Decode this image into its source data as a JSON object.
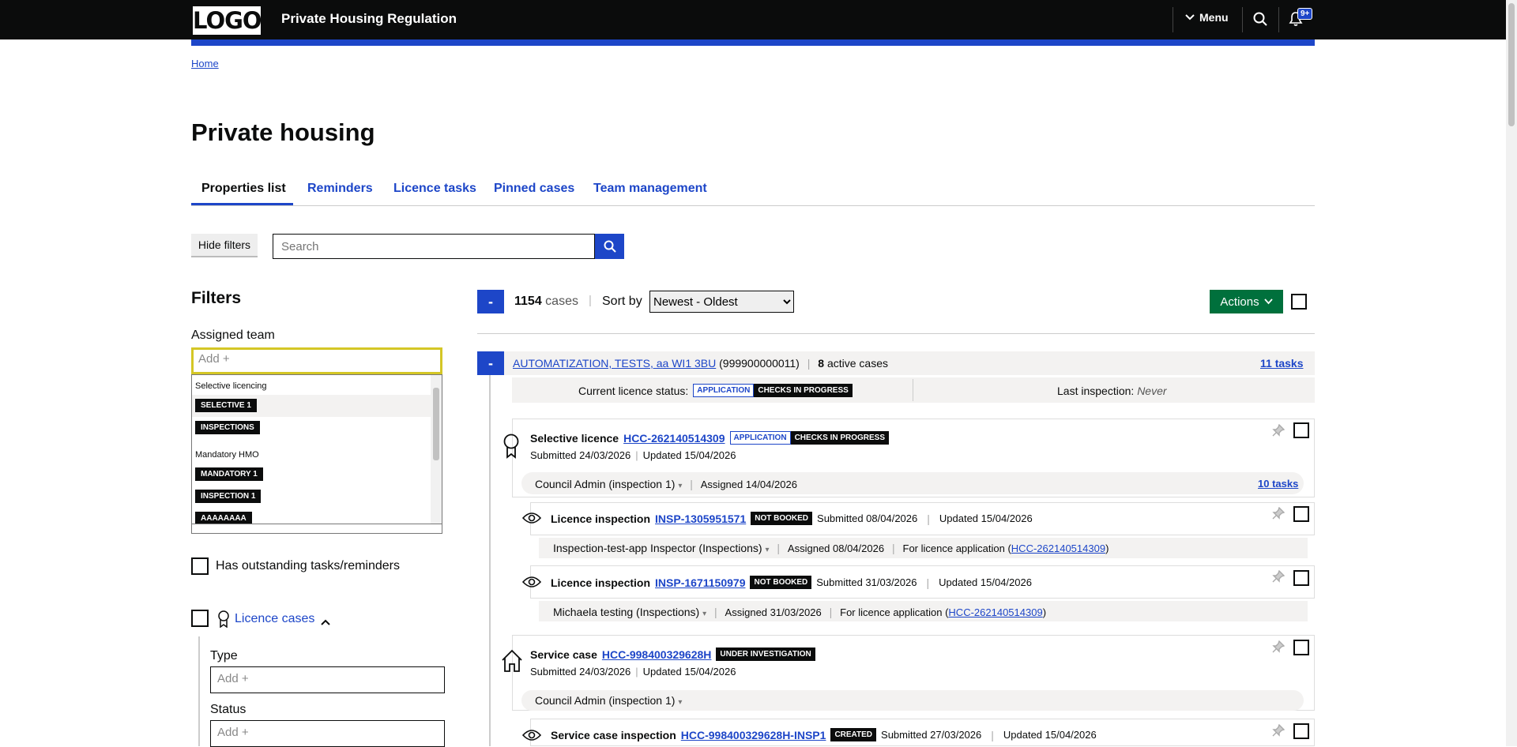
{
  "header": {
    "logo": "LOGO",
    "app_title": "Private Housing Regulation",
    "menu_label": "Menu",
    "notifications_badge": "9+"
  },
  "breadcrumb": {
    "home": "Home"
  },
  "page": {
    "title": "Private housing"
  },
  "tabs": [
    {
      "label": "Properties list",
      "active": true
    },
    {
      "label": "Reminders"
    },
    {
      "label": "Licence tasks"
    },
    {
      "label": "Pinned cases"
    },
    {
      "label": "Team management"
    }
  ],
  "toolbar": {
    "hide_filters": "Hide filters",
    "search_placeholder": "Search"
  },
  "filters": {
    "heading": "Filters",
    "assigned_team_label": "Assigned team",
    "assigned_team_placeholder": "Add +",
    "dropdown": {
      "group1": "Selective licencing",
      "group1_items": [
        "SELECTIVE 1",
        "INSPECTIONS"
      ],
      "group2": "Mandatory HMO",
      "group2_items": [
        "MANDATORY 1",
        "INSPECTION 1",
        "AAAAAAAA"
      ]
    },
    "outstanding_label": "Has outstanding tasks/reminders",
    "licence_cases_label": "Licence cases",
    "type_label": "Type",
    "type_placeholder": "Add +",
    "status_label": "Status",
    "status_placeholder": "Add +"
  },
  "results": {
    "collapse": "-",
    "count": "1154",
    "count_suffix": "cases",
    "sort_label": "Sort by",
    "sort_value": "Newest - Oldest",
    "actions_label": "Actions"
  },
  "property": {
    "collapse": "-",
    "address": "AUTOMATIZATION, TESTS, aa WI1 3BU",
    "uprn": "(999900000011)",
    "active_count": "8",
    "active_suffix": "active cases",
    "tasks": "11 tasks",
    "licence_status_label": "Current licence status:",
    "status_tag1": "APPLICATION",
    "status_tag2": "CHECKS IN PROGRESS",
    "last_inspection_label": "Last inspection:",
    "last_inspection_value": "Never"
  },
  "cases": {
    "selective": {
      "type": "Selective licence",
      "ref": "HCC-262140514309",
      "tag1": "APPLICATION",
      "tag2": "CHECKS IN PROGRESS",
      "submitted": "Submitted 24/03/2026",
      "updated": "Updated 15/04/2026",
      "assignee": "Council Admin (inspection 1)",
      "assigned": "Assigned 14/04/2026",
      "tasks": "10 tasks"
    },
    "inspection1": {
      "type": "Licence inspection",
      "ref": "INSP-1305951571",
      "tag": "NOT BOOKED",
      "submitted": "Submitted 08/04/2026",
      "updated": "Updated 15/04/2026",
      "assignee": "Inspection-test-app Inspector (Inspections)",
      "assigned": "Assigned 08/04/2026",
      "for_label": "For licence application (",
      "for_ref": "HCC-262140514309",
      "for_close": ")"
    },
    "inspection2": {
      "type": "Licence inspection",
      "ref": "INSP-1671150979",
      "tag": "NOT BOOKED",
      "submitted": "Submitted 31/03/2026",
      "updated": "Updated 15/04/2026",
      "assignee": "Michaela testing (Inspections)",
      "assigned": "Assigned 31/03/2026",
      "for_label": "For licence application (",
      "for_ref": "HCC-262140514309",
      "for_close": ")"
    },
    "service": {
      "type": "Service case",
      "ref": "HCC-998400329628H",
      "tag": "UNDER INVESTIGATION",
      "submitted": "Submitted 24/03/2026",
      "updated": "Updated 15/04/2026",
      "assignee": "Council Admin (inspection 1)"
    },
    "service_inspection": {
      "type": "Service case inspection",
      "ref": "HCC-998400329628H-INSP1",
      "tag": "CREATED",
      "submitted": "Submitted 27/03/2026",
      "updated": "Updated 15/04/2026"
    }
  }
}
